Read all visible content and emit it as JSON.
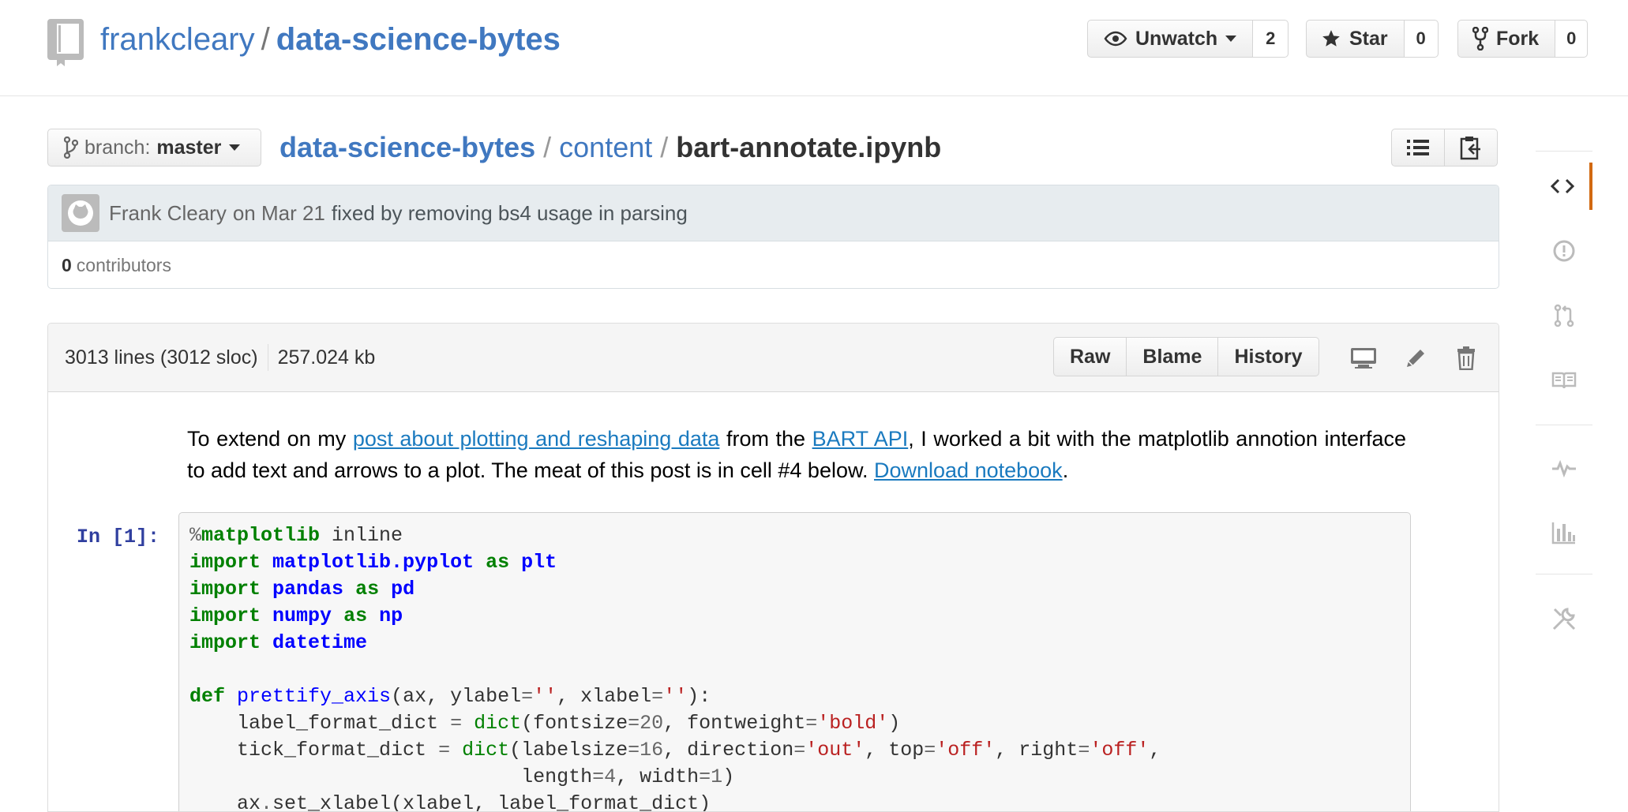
{
  "repo": {
    "owner": "frankcleary",
    "separator": "/",
    "name": "data-science-bytes"
  },
  "header_actions": {
    "unwatch_label": "Unwatch",
    "unwatch_count": "2",
    "star_label": "Star",
    "star_count": "0",
    "fork_label": "Fork",
    "fork_count": "0"
  },
  "branch": {
    "prefix": "branch:",
    "name": "master"
  },
  "breadcrumb": {
    "repo": "data-science-bytes",
    "folder": "content",
    "file": "bart-annotate.ipynb",
    "sep": "/"
  },
  "commit": {
    "author": "Frank Cleary",
    "date": "on Mar 21",
    "message": "fixed by removing bs4 usage in parsing",
    "contributors_count": "0",
    "contributors_label": "contributors"
  },
  "file": {
    "lines": "3013 lines (3012 sloc)",
    "size": "257.024 kb",
    "raw_label": "Raw",
    "blame_label": "Blame",
    "history_label": "History"
  },
  "notebook": {
    "intro_1": "To extend on my ",
    "intro_link_1": "post about plotting and reshaping data",
    "intro_2": " from the ",
    "intro_link_2": "BART API",
    "intro_3": ", I worked a bit with the matplotlib annotion interface to add text and arrows to a plot. The meat of this post is in cell #4 below. ",
    "intro_link_3": "Download notebook",
    "intro_4": ".",
    "prompt": "In [1]:"
  },
  "sidebar": {
    "items": [
      "code-icon",
      "issues-icon",
      "pull-requests-icon",
      "wiki-icon",
      "pulse-icon",
      "graphs-icon",
      "settings-icon"
    ],
    "selected": "code-icon",
    "accent": "#d26911"
  },
  "colors": {
    "link": "#4078c0",
    "keyword": "#008000",
    "module": "#0000ff",
    "string": "#ba2121",
    "prompt": "#303f9f"
  }
}
